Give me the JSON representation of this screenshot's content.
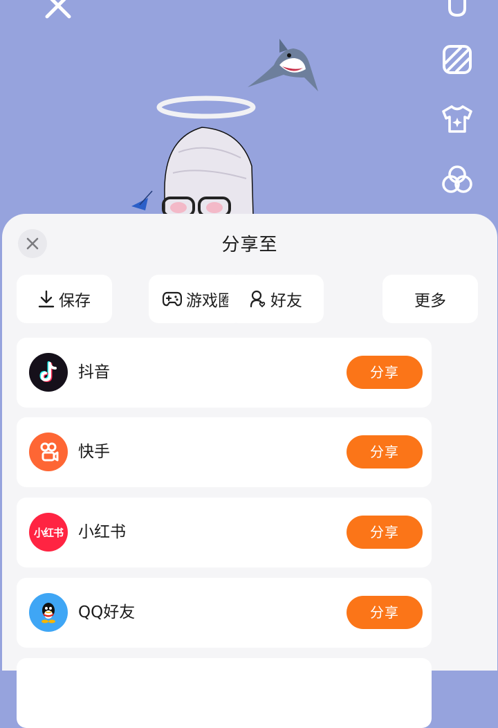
{
  "sheet": {
    "title": "分享至",
    "options": [
      {
        "label": "保存",
        "icon": "download-icon"
      },
      {
        "label": "游戏圈",
        "icon": "gamepad-icon"
      },
      {
        "label": "好友",
        "icon": "friend-icon"
      },
      {
        "label": "更多"
      }
    ],
    "apps": [
      {
        "name": "抖音",
        "icon": "douyin-icon",
        "share_label": "分享"
      },
      {
        "name": "快手",
        "icon": "kuaishou-icon",
        "share_label": "分享"
      },
      {
        "name": "小红书",
        "icon": "xiaohongshu-icon",
        "icon_text": "小红书",
        "share_label": "分享"
      },
      {
        "name": "QQ好友",
        "icon": "qq-icon",
        "share_label": "分享"
      }
    ]
  },
  "colors": {
    "background": "#96a3dd",
    "sheet": "#f5f5f7",
    "share_button": "#fb7518",
    "douyin": "#15101a",
    "kuaishou": "#fe6634",
    "xiaohongshu": "#ff2442",
    "qq": "#3fa6f5"
  }
}
